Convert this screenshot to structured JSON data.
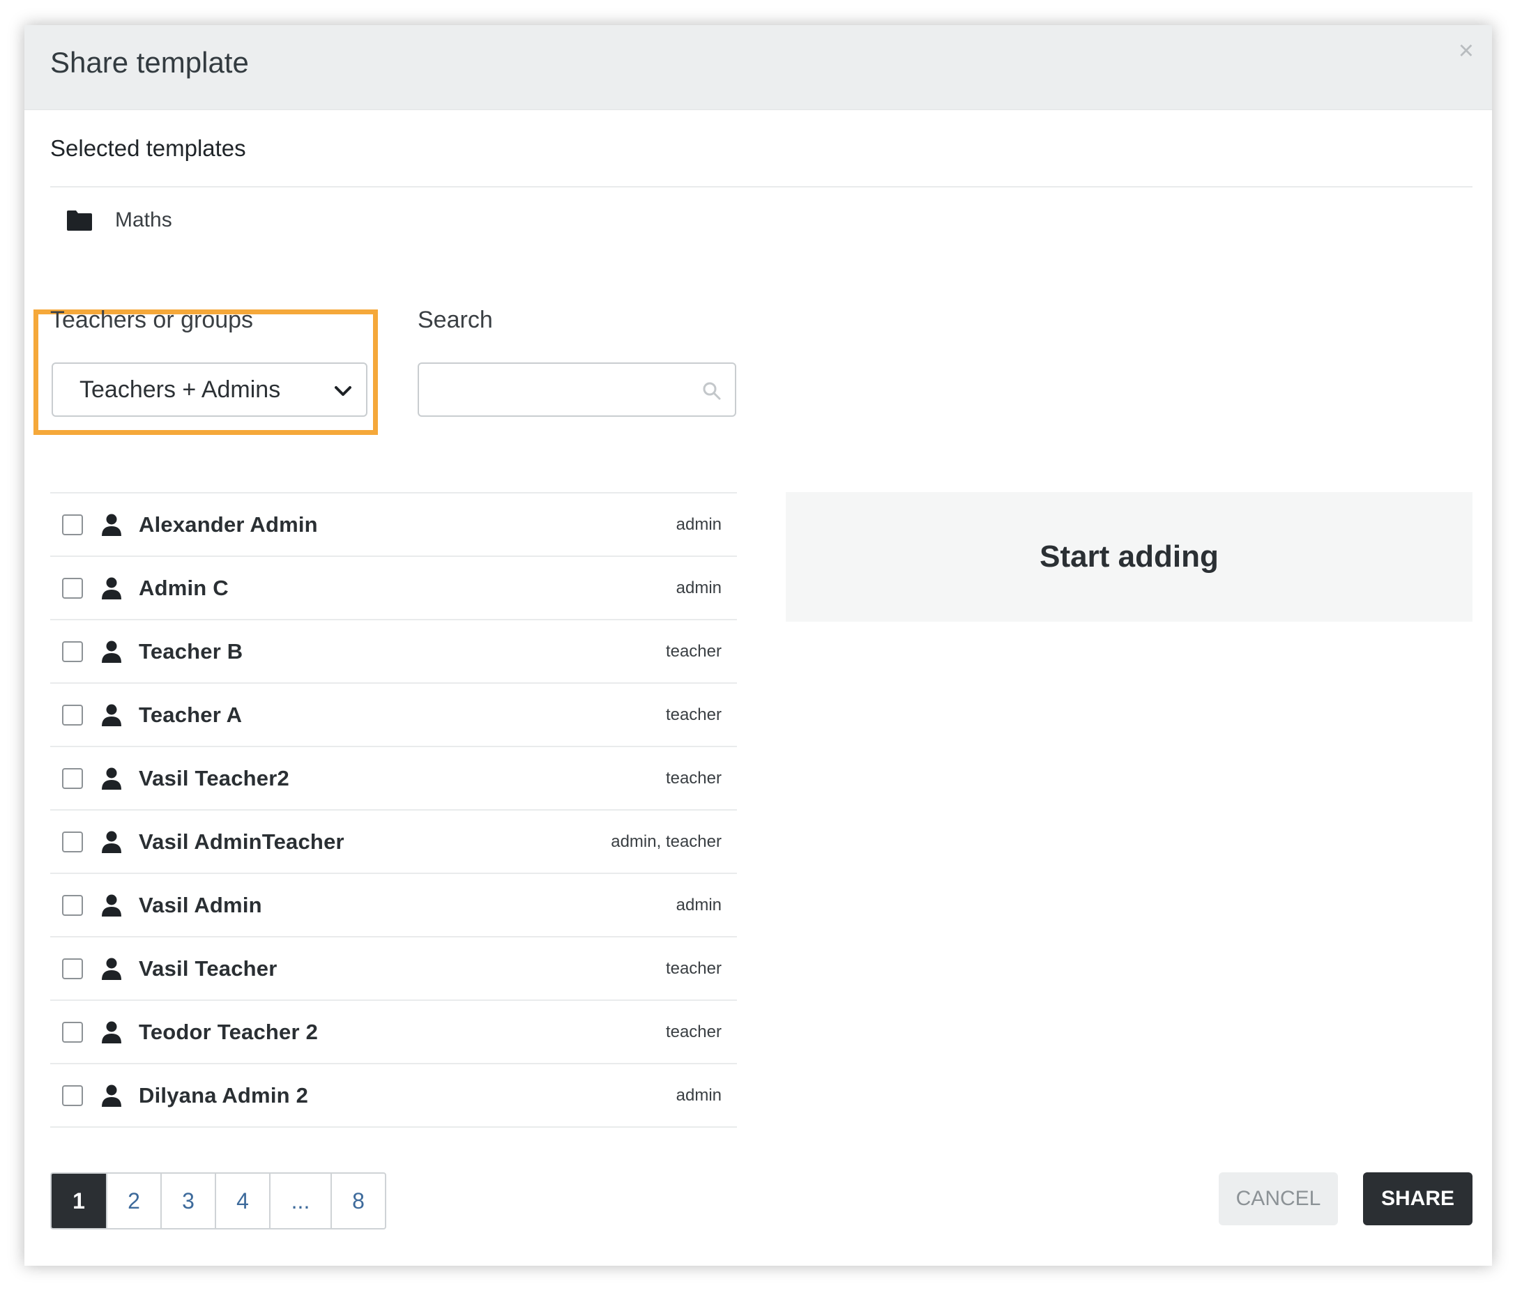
{
  "dialog": {
    "title": "Share template",
    "close_symbol": "×"
  },
  "selected_templates": {
    "heading": "Selected templates",
    "items": [
      {
        "icon": "folder-icon",
        "name": "Maths"
      }
    ]
  },
  "filters": {
    "group_label": "Teachers or groups",
    "group_selected": "Teachers + Admins",
    "search_label": "Search",
    "search_value": "",
    "highlight_color": "#f5a83a"
  },
  "users": [
    {
      "name": "Alexander Admin",
      "role": "admin",
      "checked": false
    },
    {
      "name": "Admin C",
      "role": "admin",
      "checked": false
    },
    {
      "name": "Teacher B",
      "role": "teacher",
      "checked": false
    },
    {
      "name": "Teacher A",
      "role": "teacher",
      "checked": false
    },
    {
      "name": "Vasil Teacher2",
      "role": "teacher",
      "checked": false
    },
    {
      "name": "Vasil AdminTeacher",
      "role": "admin, teacher",
      "checked": false
    },
    {
      "name": "Vasil Admin",
      "role": "admin",
      "checked": false
    },
    {
      "name": "Vasil Teacher",
      "role": "teacher",
      "checked": false
    },
    {
      "name": "Teodor Teacher 2",
      "role": "teacher",
      "checked": false
    },
    {
      "name": "Dilyana Admin 2",
      "role": "admin",
      "checked": false
    }
  ],
  "selection_panel": {
    "empty_text": "Start adding"
  },
  "pagination": {
    "pages": [
      "1",
      "2",
      "3",
      "4",
      "...",
      "8"
    ],
    "active": "1"
  },
  "actions": {
    "cancel_label": "CANCEL",
    "share_label": "SHARE"
  }
}
